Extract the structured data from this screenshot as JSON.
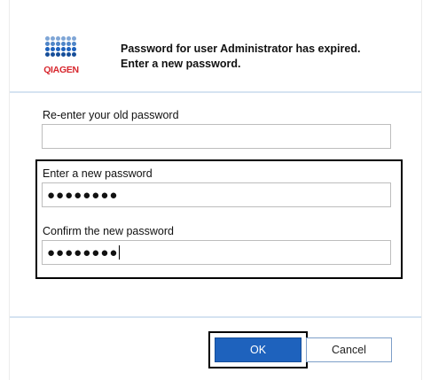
{
  "header": {
    "logo_text": "QIAGEN",
    "message_line1": "Password for user Administrator has expired.",
    "message_line2": "Enter a new password."
  },
  "form": {
    "old_password": {
      "label": "Re-enter your old password",
      "value": ""
    },
    "new_password": {
      "label": "Enter a new password",
      "value": "●●●●●●●●"
    },
    "confirm_password": {
      "label": "Confirm the new password",
      "value": "●●●●●●●●"
    }
  },
  "buttons": {
    "ok": "OK",
    "cancel": "Cancel"
  },
  "colors": {
    "brand_blue": "#1e62bd",
    "brand_red": "#d7262d",
    "divider": "#d5e3f1"
  }
}
